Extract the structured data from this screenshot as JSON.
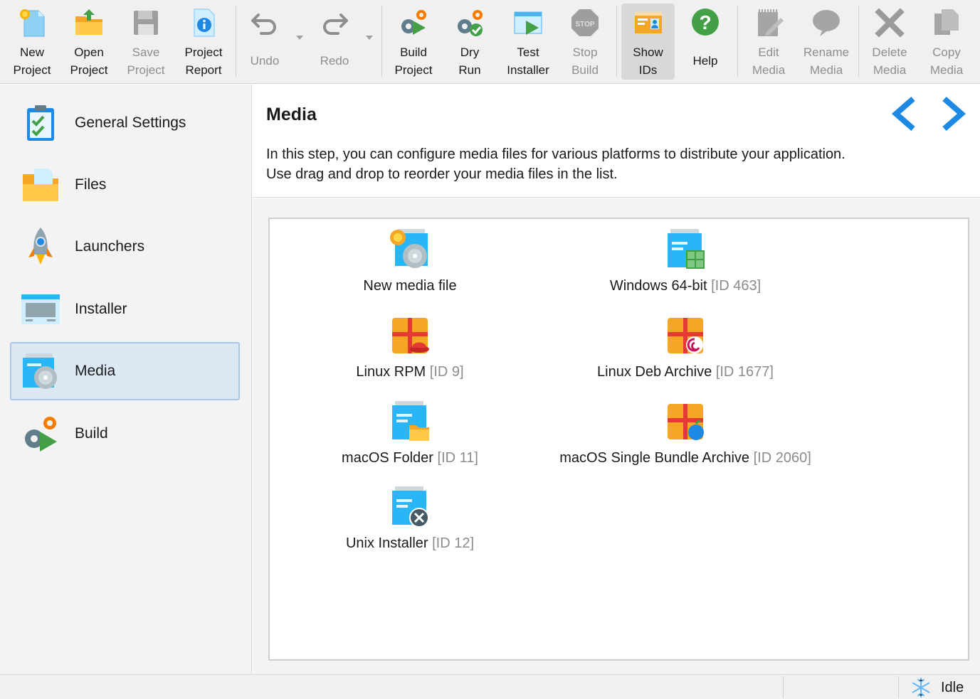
{
  "toolbar": {
    "new_project": {
      "line1": "New",
      "line2": "Project"
    },
    "open_project": {
      "line1": "Open",
      "line2": "Project"
    },
    "save_project": {
      "line1": "Save",
      "line2": "Project"
    },
    "project_report": {
      "line1": "Project",
      "line2": "Report"
    },
    "undo": {
      "label": "Undo"
    },
    "redo": {
      "label": "Redo"
    },
    "build_project": {
      "line1": "Build",
      "line2": "Project"
    },
    "dry_run": {
      "line1": "Dry",
      "line2": "Run"
    },
    "test_installer": {
      "line1": "Test",
      "line2": "Installer"
    },
    "stop_build": {
      "line1": "Stop",
      "line2": "Build",
      "icon_text": "STOP"
    },
    "show_ids": {
      "line1": "Show",
      "line2": "IDs"
    },
    "help": {
      "label": "Help"
    },
    "edit_media": {
      "line1": "Edit",
      "line2": "Media"
    },
    "rename_media": {
      "line1": "Rename",
      "line2": "Media"
    },
    "delete_media": {
      "line1": "Delete",
      "line2": "Media"
    },
    "copy_media": {
      "line1": "Copy",
      "line2": "Media"
    }
  },
  "sidebar": {
    "items": [
      {
        "label": "General Settings",
        "icon": "clipboard-check-icon"
      },
      {
        "label": "Files",
        "icon": "folder-icon"
      },
      {
        "label": "Launchers",
        "icon": "rocket-icon"
      },
      {
        "label": "Installer",
        "icon": "installer-window-icon"
      },
      {
        "label": "Media",
        "icon": "media-disc-icon",
        "selected": true
      },
      {
        "label": "Build",
        "icon": "build-gears-icon"
      }
    ]
  },
  "main": {
    "title": "Media",
    "description": "In this step, you can configure media files for various platforms to distribute your application. Use drag and drop to reorder your media files in the list."
  },
  "media": {
    "items": [
      {
        "name": "New media file",
        "id": "",
        "icon": "new-media-icon"
      },
      {
        "name": "Windows 64-bit",
        "id": "[ID 463]",
        "icon": "windows-media-icon"
      },
      {
        "name": "Linux RPM",
        "id": "[ID 9]",
        "icon": "linux-rpm-icon"
      },
      {
        "name": "Linux Deb Archive",
        "id": "[ID 1677]",
        "icon": "linux-deb-icon"
      },
      {
        "name": "macOS Folder",
        "id": "[ID 11]",
        "icon": "macos-folder-icon"
      },
      {
        "name": "macOS Single Bundle Archive",
        "id": "[ID 2060]",
        "icon": "macos-archive-icon"
      },
      {
        "name": "Unix Installer",
        "id": "[ID 12]",
        "icon": "unix-installer-icon"
      }
    ]
  },
  "status": {
    "text": "Idle",
    "icon": "snowflake-icon"
  },
  "colors": {
    "accent_blue": "#1e88e5",
    "orange": "#f5a623",
    "selected_bg": "#dce8f4"
  }
}
